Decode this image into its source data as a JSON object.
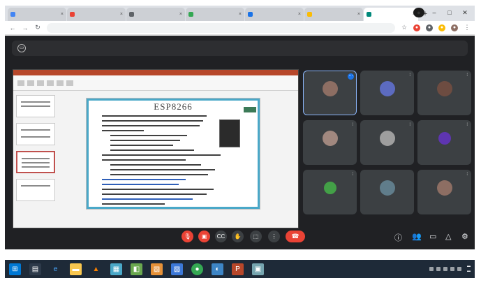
{
  "browser": {
    "tabs": [
      {
        "label": "",
        "color": "#4285f4"
      },
      {
        "label": "",
        "color": "#ea4335"
      },
      {
        "label": "",
        "color": "#5f6368"
      },
      {
        "label": "",
        "color": "#34a853"
      },
      {
        "label": "",
        "color": "#1a73e8"
      },
      {
        "label": "",
        "color": "#fbbc04"
      },
      {
        "label": "",
        "color": "#00897b",
        "active": true
      }
    ],
    "address": "",
    "new_tab_glyph": "+",
    "close_glyph": "×"
  },
  "meet": {
    "presenting_text": "",
    "meeting_code": "",
    "slide": {
      "title": "ESP8266"
    },
    "participants": [
      {
        "name": "",
        "face": "#8d6e63"
      },
      {
        "name": "",
        "face": "#5c6bc0"
      },
      {
        "name": "",
        "face": "#6d4c41"
      },
      {
        "name": "",
        "face": "#a1887f"
      },
      {
        "name": "",
        "face": "#9e9e9e"
      },
      {
        "name": "",
        "face": "#5e35b1",
        "letter": ""
      },
      {
        "name": "",
        "face": "#43a047",
        "letter": ""
      },
      {
        "name": "",
        "face": "#607d8b"
      },
      {
        "name": "",
        "face": "#8d6e63"
      }
    ]
  },
  "colors": {
    "meet_bg": "#202124",
    "tile_bg": "#3c4043",
    "end_call": "#ea4335",
    "taskbar": "#1e2a38"
  },
  "taskbar": {
    "apps": [
      {
        "icon": "edge-icon",
        "color": "#0078d4"
      },
      {
        "icon": "file-explorer-icon",
        "color": "#f9c74f"
      },
      {
        "icon": "vlc-icon",
        "color": "#f77f00"
      },
      {
        "icon": "photos-icon",
        "color": "#4aa8c8"
      },
      {
        "icon": "chrome-icon",
        "color": "#34a853"
      },
      {
        "icon": "powerpoint-icon",
        "color": "#b7472a"
      }
    ]
  }
}
